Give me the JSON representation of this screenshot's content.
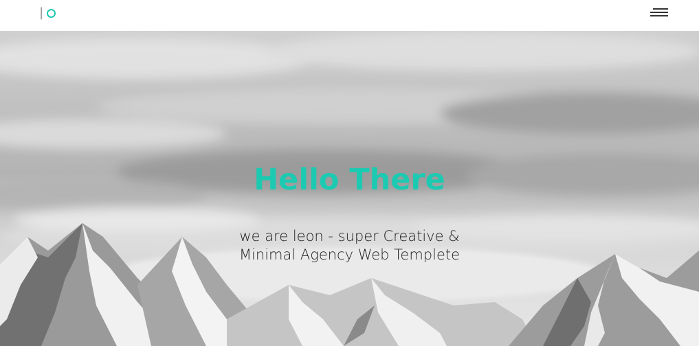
{
  "header": {
    "logo_bar": "|",
    "logo_icon": "circle-icon",
    "menu_icon": "hamburger-menu-icon"
  },
  "hero": {
    "title": "Hello There",
    "subtitle_line1": "we are leon - super Creative &",
    "subtitle_line2": "Minimal Agency Web Templete",
    "background": "grayscale-mountains-clouds-photo"
  },
  "colors": {
    "accent": "#1ccab1",
    "text_dark": "#222222",
    "header_bg": "#ffffff"
  }
}
